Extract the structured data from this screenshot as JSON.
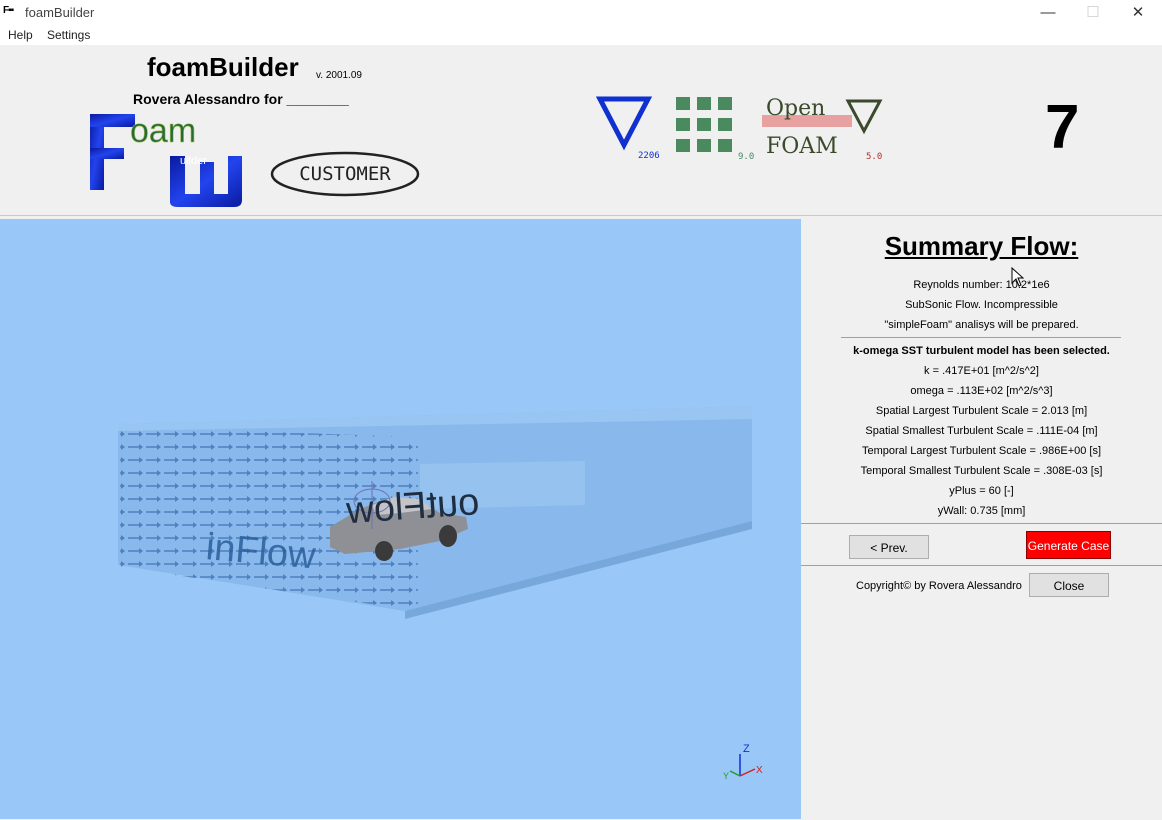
{
  "window": {
    "title": "foamBuilder",
    "icon_text": "F▪▪"
  },
  "menu": [
    "Help",
    "Settings"
  ],
  "header": {
    "app_name": "foamBuilder",
    "version": "v. 2001.09",
    "author": "Rovera Alessandro for ________",
    "customer_logo_text": "CUSTOMER",
    "logo_texts": {
      "foam": "oam",
      "builder": "uilder"
    },
    "versions": {
      "openfoam_com": "2206",
      "foam_extend": "9.0",
      "openfoam_org": "5.0"
    },
    "openfoam_logo": {
      "line1": "Open",
      "line2": "FOAM"
    },
    "big_number": "7"
  },
  "viewport": {
    "labels": {
      "inflow": "inFlow",
      "outflow": "outFlow"
    },
    "axes": {
      "z": "Z",
      "x": "X",
      "y": "Y"
    }
  },
  "summary": {
    "title": "Summary Flow:",
    "reynolds": "Reynolds number:    10.2*1e6",
    "flow_type": "SubSonic Flow. Incompressible",
    "solver": "\"simpleFoam\" analisys will be prepared.",
    "model": "k-omega SST turbulent model has been selected.",
    "k": "k = .417E+01 [m^2/s^2]",
    "omega": "omega = .113E+02 [m^2/s^3]",
    "spatial_largest": "Spatial  Largest  Turbulent Scale =  2.013 [m]",
    "spatial_smallest": "Spatial  Smallest Turbulent Scale = .111E-04 [m]",
    "temporal_largest": "Temporal Largest  Turbulent Scale = .986E+00 [s]",
    "temporal_smallest": "Temporal Smallest Turbulent Scale = .308E-03 [s]",
    "yplus": "yPlus =      60 [-]",
    "ywall": "yWall:        0.735 [mm]"
  },
  "buttons": {
    "prev": "< Prev.",
    "generate": "Generate Case",
    "close": "Close"
  },
  "copyright": "Copyright© by Rovera Alessandro",
  "colors": {
    "viewport_bg": "#99c8f8",
    "generate_btn": "#ff0000",
    "logo_blue": "#1030d0",
    "grid_green": "#4a8a5e"
  }
}
